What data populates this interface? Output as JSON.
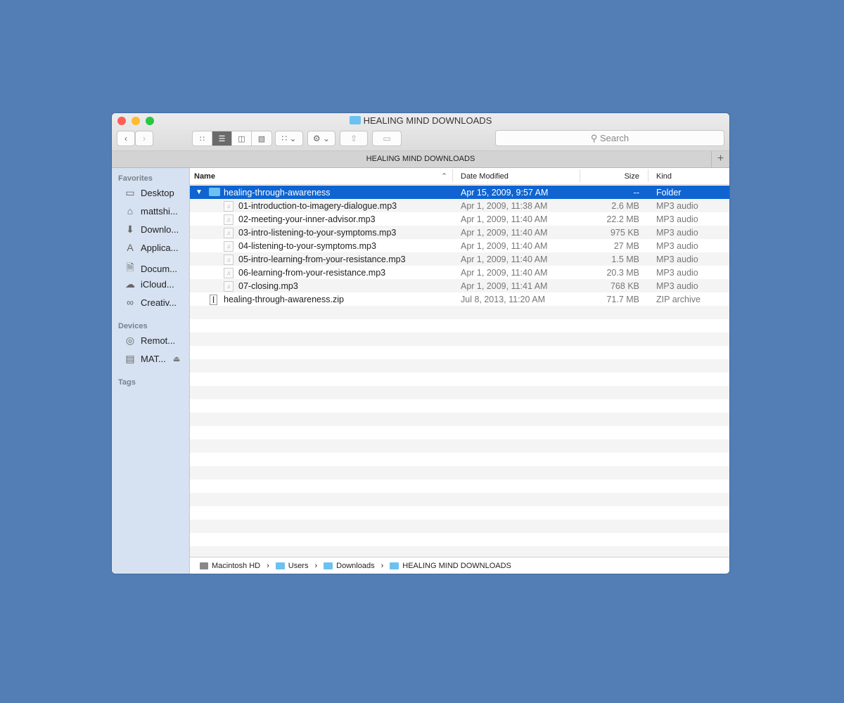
{
  "window": {
    "title": "HEALING MIND DOWNLOADS",
    "tab": "HEALING MIND DOWNLOADS",
    "search_placeholder": "Search"
  },
  "sidebar": {
    "favorites_label": "Favorites",
    "favorites": [
      {
        "label": "Desktop",
        "icon": "desktop-icon"
      },
      {
        "label": "mattshi...",
        "icon": "home-icon"
      },
      {
        "label": "Downlo...",
        "icon": "downloads-icon"
      },
      {
        "label": "Applica...",
        "icon": "applications-icon"
      },
      {
        "label": "Docum...",
        "icon": "documents-icon"
      },
      {
        "label": "iCloud...",
        "icon": "icloud-icon"
      },
      {
        "label": "Creativ...",
        "icon": "creative-cloud-icon"
      }
    ],
    "devices_label": "Devices",
    "devices": [
      {
        "label": "Remot...",
        "icon": "disc-icon"
      },
      {
        "label": "MAT...",
        "icon": "drive-icon"
      }
    ],
    "tags_label": "Tags"
  },
  "columns": {
    "name": "Name",
    "date": "Date Modified",
    "size": "Size",
    "kind": "Kind"
  },
  "rows": [
    {
      "name": "healing-through-awareness",
      "date": "Apr 15, 2009, 9:57 AM",
      "size": "--",
      "kind": "Folder",
      "type": "folder"
    },
    {
      "name": "01-introduction-to-imagery-dialogue.mp3",
      "date": "Apr 1, 2009, 11:38 AM",
      "size": "2.6 MB",
      "kind": "MP3 audio",
      "type": "mp3"
    },
    {
      "name": "02-meeting-your-inner-advisor.mp3",
      "date": "Apr 1, 2009, 11:40 AM",
      "size": "22.2 MB",
      "kind": "MP3 audio",
      "type": "mp3"
    },
    {
      "name": "03-intro-listening-to-your-symptoms.mp3",
      "date": "Apr 1, 2009, 11:40 AM",
      "size": "975 KB",
      "kind": "MP3 audio",
      "type": "mp3"
    },
    {
      "name": "04-listening-to-your-symptoms.mp3",
      "date": "Apr 1, 2009, 11:40 AM",
      "size": "27 MB",
      "kind": "MP3 audio",
      "type": "mp3"
    },
    {
      "name": "05-intro-learning-from-your-resistance.mp3",
      "date": "Apr 1, 2009, 11:40 AM",
      "size": "1.5 MB",
      "kind": "MP3 audio",
      "type": "mp3"
    },
    {
      "name": "06-learning-from-your-resistance.mp3",
      "date": "Apr 1, 2009, 11:40 AM",
      "size": "20.3 MB",
      "kind": "MP3 audio",
      "type": "mp3"
    },
    {
      "name": "07-closing.mp3",
      "date": "Apr 1, 2009, 11:41 AM",
      "size": "768 KB",
      "kind": "MP3 audio",
      "type": "mp3"
    },
    {
      "name": "healing-through-awareness.zip",
      "date": "Jul 8, 2013, 11:20 AM",
      "size": "71.7 MB",
      "kind": "ZIP archive",
      "type": "zip"
    }
  ],
  "path": [
    "Macintosh HD",
    "Users",
    "Downloads",
    "HEALING MIND DOWNLOADS"
  ]
}
